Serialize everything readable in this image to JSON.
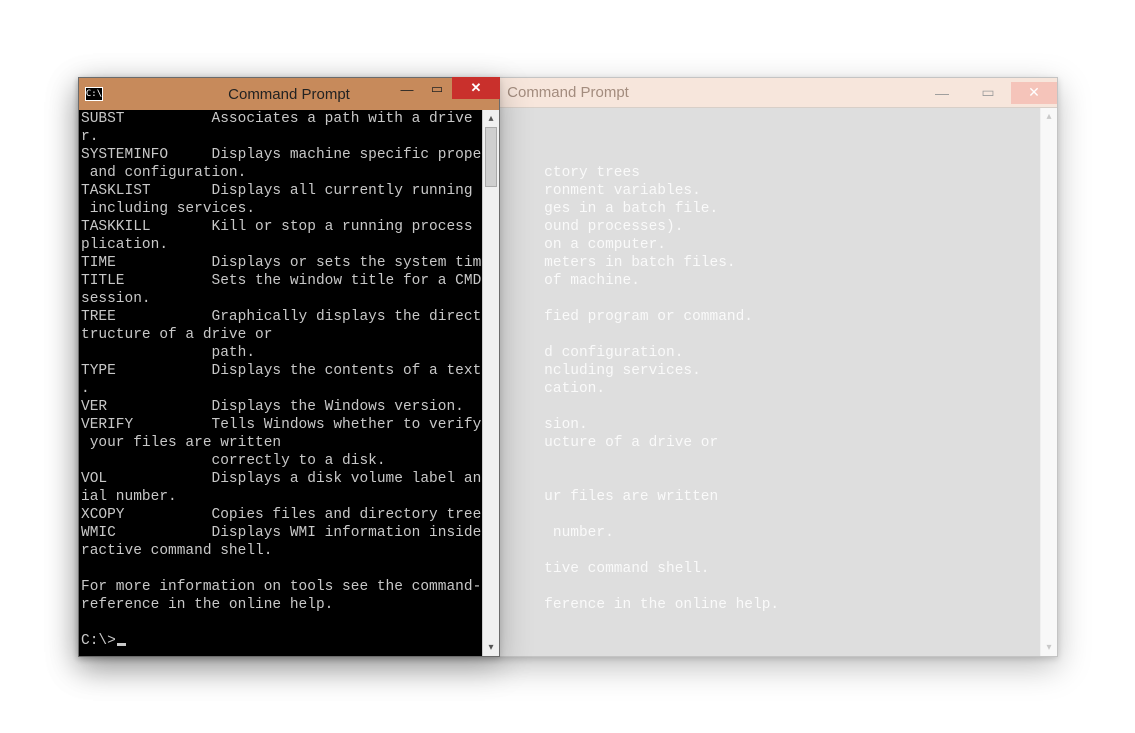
{
  "front": {
    "title": "Command Prompt",
    "icon_text": "C:\\",
    "console_text": "SUBST          Associates a path with a drive lette\nr.\nSYSTEMINFO     Displays machine specific properties\n and configuration.\nTASKLIST       Displays all currently running tasks\n including services.\nTASKKILL       Kill or stop a running process or ap\nplication.\nTIME           Displays or sets the system time.\nTITLE          Sets the window title for a CMD.EXE \nsession.\nTREE           Graphically displays the directory s\ntructure of a drive or\n               path.\nTYPE           Displays the contents of a text file\n.\nVER            Displays the Windows version.\nVERIFY         Tells Windows whether to verify that\n your files are written\n               correctly to a disk.\nVOL            Displays a disk volume label and ser\nial number.\nXCOPY          Copies files and directory trees.\nWMIC           Displays WMI information inside inte\nractive command shell.\n\nFor more information on tools see the command-line \nreference in the online help.\n\nC:\\>"
  },
  "back": {
    "title": "Command Prompt",
    "console_text": "\n\n\n                                                     ctory trees\n                                                     ronment variables.\n                                                     ges in a batch file.\n                                                     ound processes).\n                                                     on a computer.\n                                                     meters in batch files.\n                                                     of machine.\n\n                                                     fied program or command.\n\n                                                     d configuration.\n                                                     ncluding services.\n                                                     cation.\n\n                                                     sion.\n                                                     ucture of a drive or\n\n\n                                                     ur files are written\n\n                                                      number.\n\n                                                     tive command shell.\n\n                                                     ference in the online help.\n"
  },
  "glyphs": {
    "minimize": "—",
    "maximize": "▭",
    "close": "✕",
    "up": "▴",
    "down": "▾"
  }
}
